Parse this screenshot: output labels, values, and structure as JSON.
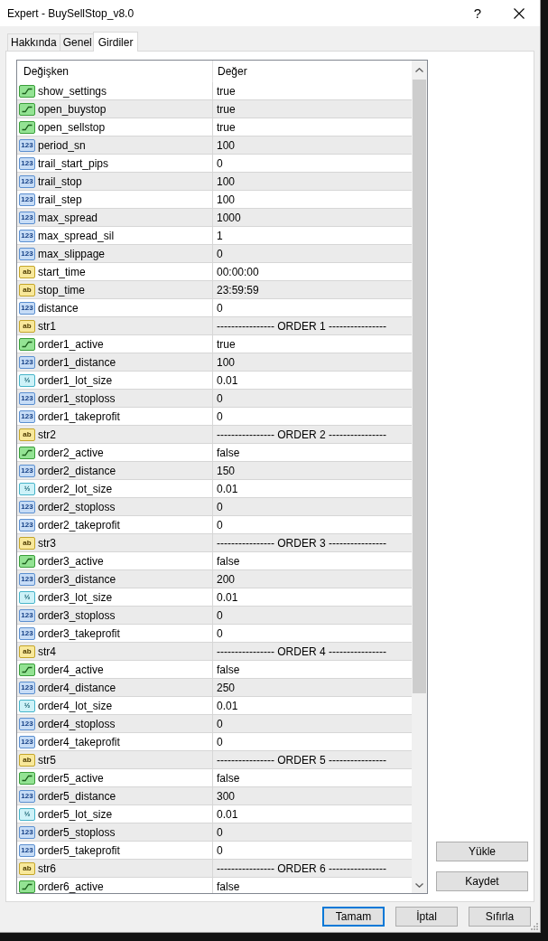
{
  "window": {
    "title": "Expert - BuySellStop_v8.0",
    "help": "?"
  },
  "tabs": [
    {
      "label": "Hakkında",
      "selected": false
    },
    {
      "label": "Genel",
      "selected": false
    },
    {
      "label": "Girdiler",
      "selected": true
    }
  ],
  "table": {
    "columns": [
      "Değişken",
      "Değer"
    ],
    "rows": [
      {
        "kind": "bool",
        "name": "show_settings",
        "value": "true"
      },
      {
        "kind": "bool",
        "name": "open_buystop",
        "value": "true"
      },
      {
        "kind": "bool",
        "name": "open_sellstop",
        "value": "true"
      },
      {
        "kind": "int",
        "badge": "123",
        "name": "period_sn",
        "value": "100"
      },
      {
        "kind": "int",
        "badge": "123",
        "name": "trail_start_pips",
        "value": "0"
      },
      {
        "kind": "int",
        "badge": "123",
        "name": "trail_stop",
        "value": "100"
      },
      {
        "kind": "int",
        "badge": "123",
        "name": "trail_step",
        "value": "100"
      },
      {
        "kind": "int",
        "badge": "123",
        "name": "max_spread",
        "value": "1000"
      },
      {
        "kind": "int",
        "badge": "123",
        "name": "max_spread_sil",
        "value": "1"
      },
      {
        "kind": "int",
        "badge": "123",
        "name": "max_slippage",
        "value": "0"
      },
      {
        "kind": "string",
        "badge": "ab",
        "name": "start_time",
        "value": "00:00:00"
      },
      {
        "kind": "string",
        "badge": "ab",
        "name": "stop_time",
        "value": "23:59:59"
      },
      {
        "kind": "int",
        "badge": "123",
        "name": "distance",
        "value": "0"
      },
      {
        "kind": "string",
        "badge": "ab",
        "name": "str1",
        "value": "---------------- ORDER 1 ----------------"
      },
      {
        "kind": "bool",
        "name": "order1_active",
        "value": "true"
      },
      {
        "kind": "int",
        "badge": "123",
        "name": "order1_distance",
        "value": "100"
      },
      {
        "kind": "double",
        "badge": "½",
        "name": "order1_lot_size",
        "value": "0.01"
      },
      {
        "kind": "int",
        "badge": "123",
        "name": "order1_stoploss",
        "value": "0"
      },
      {
        "kind": "int",
        "badge": "123",
        "name": "order1_takeprofit",
        "value": "0"
      },
      {
        "kind": "string",
        "badge": "ab",
        "name": "str2",
        "value": "---------------- ORDER 2 ----------------"
      },
      {
        "kind": "bool",
        "name": "order2_active",
        "value": "false"
      },
      {
        "kind": "int",
        "badge": "123",
        "name": "order2_distance",
        "value": "150"
      },
      {
        "kind": "double",
        "badge": "½",
        "name": "order2_lot_size",
        "value": "0.01"
      },
      {
        "kind": "int",
        "badge": "123",
        "name": "order2_stoploss",
        "value": "0"
      },
      {
        "kind": "int",
        "badge": "123",
        "name": "order2_takeprofit",
        "value": "0"
      },
      {
        "kind": "string",
        "badge": "ab",
        "name": "str3",
        "value": "---------------- ORDER 3 ----------------"
      },
      {
        "kind": "bool",
        "name": "order3_active",
        "value": "false"
      },
      {
        "kind": "int",
        "badge": "123",
        "name": "order3_distance",
        "value": "200"
      },
      {
        "kind": "double",
        "badge": "½",
        "name": "order3_lot_size",
        "value": "0.01"
      },
      {
        "kind": "int",
        "badge": "123",
        "name": "order3_stoploss",
        "value": "0"
      },
      {
        "kind": "int",
        "badge": "123",
        "name": "order3_takeprofit",
        "value": "0"
      },
      {
        "kind": "string",
        "badge": "ab",
        "name": "str4",
        "value": "---------------- ORDER 4 ----------------"
      },
      {
        "kind": "bool",
        "name": "order4_active",
        "value": "false"
      },
      {
        "kind": "int",
        "badge": "123",
        "name": "order4_distance",
        "value": "250"
      },
      {
        "kind": "double",
        "badge": "½",
        "name": "order4_lot_size",
        "value": "0.01"
      },
      {
        "kind": "int",
        "badge": "123",
        "name": "order4_stoploss",
        "value": "0"
      },
      {
        "kind": "int",
        "badge": "123",
        "name": "order4_takeprofit",
        "value": "0"
      },
      {
        "kind": "string",
        "badge": "ab",
        "name": "str5",
        "value": "---------------- ORDER 5 ----------------"
      },
      {
        "kind": "bool",
        "name": "order5_active",
        "value": "false"
      },
      {
        "kind": "int",
        "badge": "123",
        "name": "order5_distance",
        "value": "300"
      },
      {
        "kind": "double",
        "badge": "½",
        "name": "order5_lot_size",
        "value": "0.01"
      },
      {
        "kind": "int",
        "badge": "123",
        "name": "order5_stoploss",
        "value": "0"
      },
      {
        "kind": "int",
        "badge": "123",
        "name": "order5_takeprofit",
        "value": "0"
      },
      {
        "kind": "string",
        "badge": "ab",
        "name": "str6",
        "value": "---------------- ORDER 6 ----------------"
      },
      {
        "kind": "bool",
        "name": "order6_active",
        "value": "false"
      }
    ]
  },
  "side_buttons": [
    "Yükle",
    "Kaydet"
  ],
  "footer_buttons": [
    {
      "label": "Tamam",
      "default": true
    },
    {
      "label": "İptal",
      "default": false
    },
    {
      "label": "Sıfırla",
      "default": false
    }
  ]
}
